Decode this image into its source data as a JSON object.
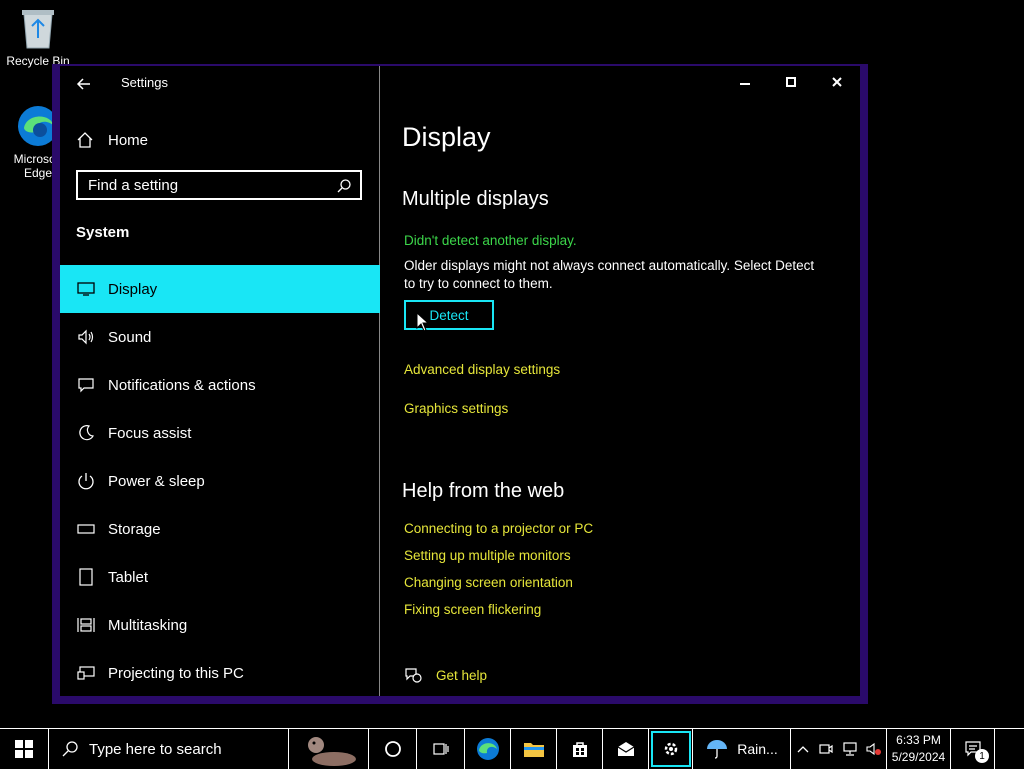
{
  "desktop": {
    "recycle_label": "Recycle Bin",
    "edge_label": "Microsoft Edge"
  },
  "window": {
    "title": "Settings"
  },
  "sidebar": {
    "home": "Home",
    "search_placeholder": "Find a setting",
    "section": "System",
    "items": [
      {
        "label": "Display",
        "icon": "monitor-icon"
      },
      {
        "label": "Sound",
        "icon": "speaker-icon"
      },
      {
        "label": "Notifications & actions",
        "icon": "notification-icon"
      },
      {
        "label": "Focus assist",
        "icon": "moon-icon"
      },
      {
        "label": "Power & sleep",
        "icon": "power-icon"
      },
      {
        "label": "Storage",
        "icon": "storage-icon"
      },
      {
        "label": "Tablet",
        "icon": "tablet-icon"
      },
      {
        "label": "Multitasking",
        "icon": "multitasking-icon"
      },
      {
        "label": "Projecting to this PC",
        "icon": "projecting-icon"
      }
    ]
  },
  "main": {
    "title": "Display",
    "multiple_displays": "Multiple displays",
    "status": "Didn't detect another display.",
    "info_line1": "Older displays might not always connect automatically. Select Detect",
    "info_line2": "to try to connect to them.",
    "detect_label": "Detect",
    "advanced_link": "Advanced display settings",
    "graphics_link": "Graphics settings",
    "help_heading": "Help from the web",
    "help_links": [
      "Connecting to a projector or PC",
      "Setting up multiple monitors",
      "Changing screen orientation",
      "Fixing screen flickering"
    ],
    "get_help": "Get help"
  },
  "taskbar": {
    "search_placeholder": "Type here to search",
    "weather": "Rain...",
    "time": "6:33 PM",
    "date": "5/29/2024",
    "notification_count": "1"
  },
  "colors": {
    "accent": "#19e6f5",
    "link": "#e6e63a",
    "status": "#3cd64a",
    "window_frame": "#2a0a6a"
  }
}
